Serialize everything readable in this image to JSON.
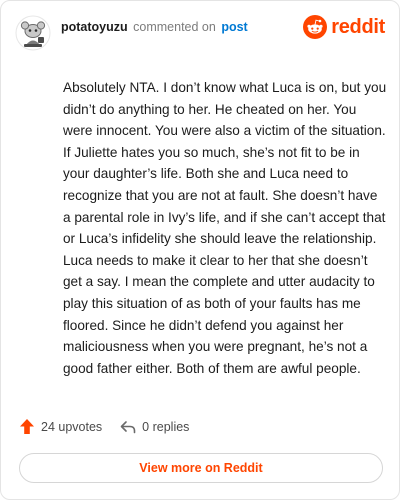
{
  "header": {
    "username": "potatoyuzu",
    "action_text": "commented on",
    "post_link": "post",
    "brand_name": "reddit"
  },
  "comment": {
    "body": "Absolutely NTA. I don’t know what Luca is on, but you didn’t do anything to her. He cheated on her. You were innocent. You were also a victim of the situation. If Juliette hates you so much, she’s not fit to be in your daughter’s life. Both she and Luca need to recognize that you are not at fault. She doesn’t have a parental role in Ivy’s life, and if she can’t accept that or Luca’s infidelity she should leave the relationship. Luca needs to make it clear to her that she doesn’t get a say. I mean the complete and utter audacity to play this situation of as both of your faults has me floored. Since he didn’t defend you against her maliciousness when you were pregnant, he’s not a good father either. Both of them are awful people."
  },
  "actions": {
    "upvotes": "24 upvotes",
    "replies": "0 replies"
  },
  "footer": {
    "view_more": "View more on Reddit"
  },
  "colors": {
    "brand": "#ff4500",
    "link": "#0079d3",
    "text": "#1c1c1c",
    "muted": "#7c7c7c"
  },
  "icons": {
    "avatar": "snoo-avatar",
    "brand": "reddit-logo-icon",
    "upvote": "upvote-arrow-icon",
    "reply": "reply-arrow-icon"
  }
}
